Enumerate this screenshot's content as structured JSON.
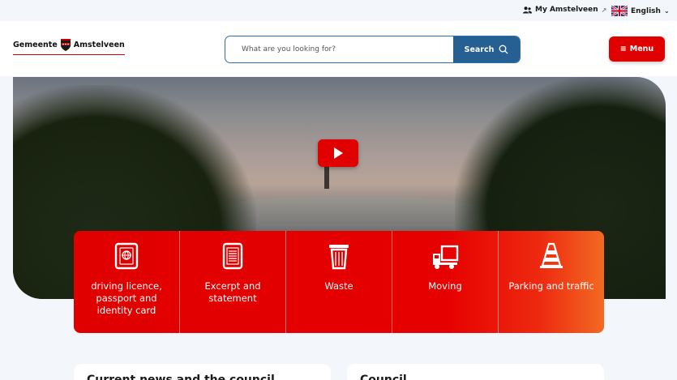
{
  "utility": {
    "my_link": "My Amstelveen",
    "language": "English"
  },
  "header": {
    "logo_left": "Gemeente",
    "logo_right": "Amstelveen",
    "search_placeholder": "What are you looking for?",
    "search_button": "Search",
    "menu_button": "Menu"
  },
  "tiles": [
    {
      "label": "driving licence, passport and identity card",
      "icon": "passport-icon"
    },
    {
      "label": "Excerpt and statement",
      "icon": "document-icon"
    },
    {
      "label": "Waste",
      "icon": "trash-bin-icon"
    },
    {
      "label": "Moving",
      "icon": "moving-truck-icon"
    },
    {
      "label": "Parking and traffic",
      "icon": "traffic-cone-icon"
    }
  ],
  "cards": [
    {
      "title": "Current news and the council"
    },
    {
      "title": "Council"
    }
  ],
  "colors": {
    "brand_red": "#e00000",
    "search_blue": "#265f91"
  }
}
